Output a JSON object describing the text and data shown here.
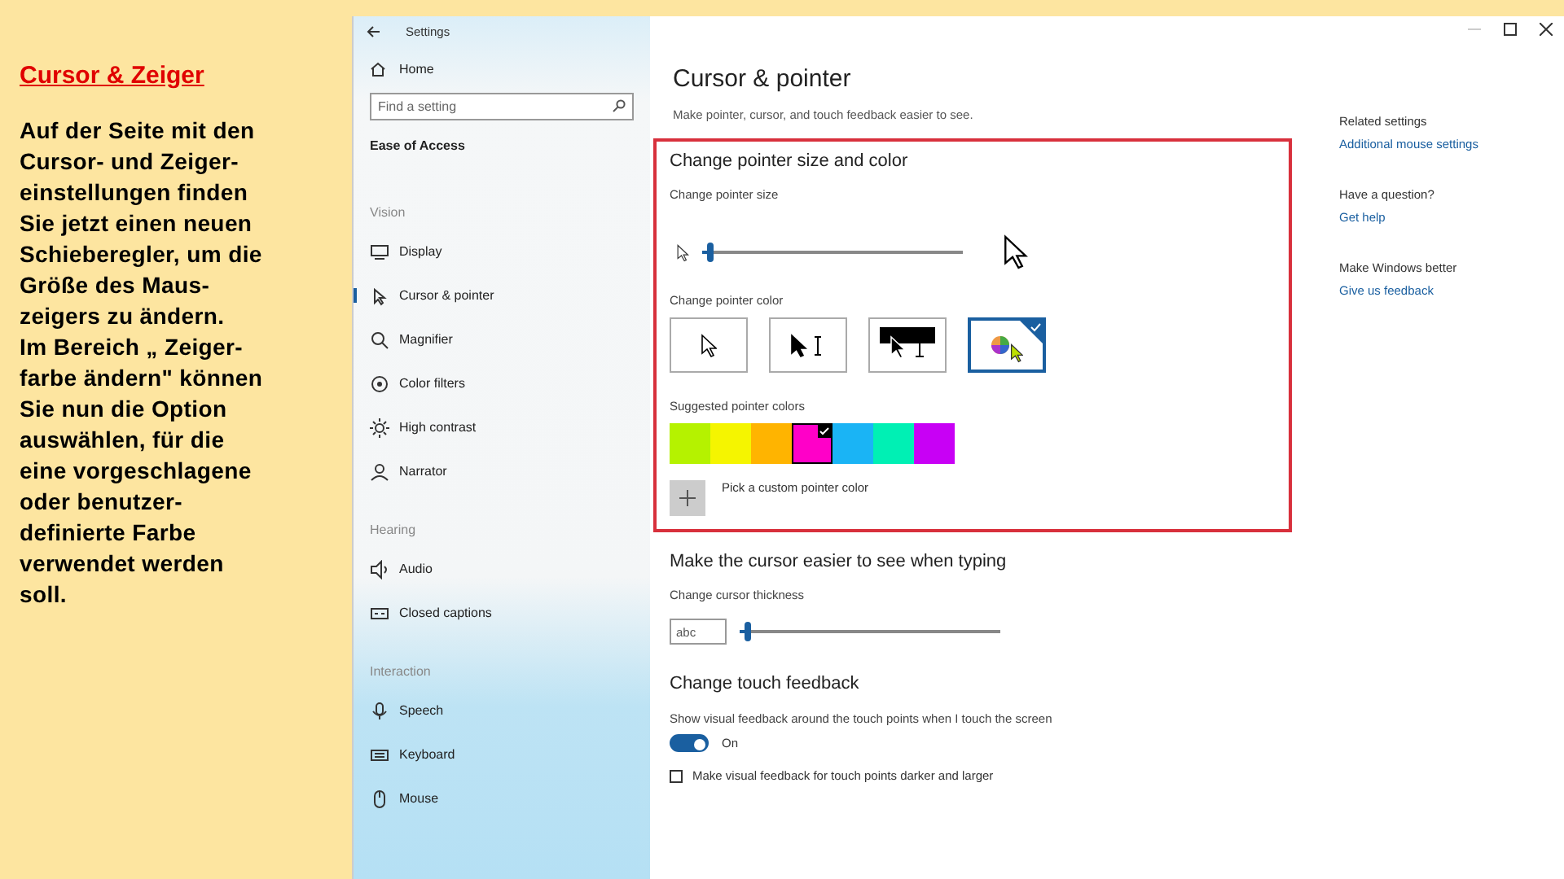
{
  "slide": {
    "title": "Cursor & Zeiger",
    "body": "Auf der Seite mit den\nCursor- und Zeiger-\neinstellungen finden\nSie jetzt einen neuen\nSchieberegler, um die\nGröße des Maus-\nzeigers zu ändern.\nIm Bereich „ Zeiger-\nfarbe ändern\" können\nSie nun die Option\nauswählen, für die\neine vorgeschlagene\noder benutzer-\ndefinierte Farbe\nverwendet werden\nsoll."
  },
  "window": {
    "title": "Settings"
  },
  "sidebar": {
    "home": "Home",
    "search": {
      "placeholder": "Find a setting"
    },
    "heading": "Ease of Access",
    "groups": [
      {
        "label": "Vision",
        "items": [
          {
            "label": "Display",
            "selected": false
          },
          {
            "label": "Cursor & pointer",
            "selected": true
          },
          {
            "label": "Magnifier",
            "selected": false
          },
          {
            "label": "Color filters",
            "selected": false
          },
          {
            "label": "High contrast",
            "selected": false
          },
          {
            "label": "Narrator",
            "selected": false
          }
        ]
      },
      {
        "label": "Hearing",
        "items": [
          {
            "label": "Audio",
            "selected": false
          },
          {
            "label": "Closed captions",
            "selected": false
          }
        ]
      },
      {
        "label": "Interaction",
        "items": [
          {
            "label": "Speech",
            "selected": false
          },
          {
            "label": "Keyboard",
            "selected": false
          },
          {
            "label": "Mouse",
            "selected": false
          }
        ]
      }
    ]
  },
  "main": {
    "title": "Cursor & pointer",
    "subtitle": "Make pointer, cursor, and touch feedback easier to see.",
    "pointer_section": {
      "heading": "Change pointer size and color",
      "size_label": "Change pointer size",
      "size_slider": {
        "level": 0.02
      },
      "color_label": "Change pointer color",
      "color_options": [
        {
          "kind": "white",
          "selected": false
        },
        {
          "kind": "black",
          "selected": false
        },
        {
          "kind": "inverted",
          "selected": false
        },
        {
          "kind": "custom",
          "selected": true
        }
      ],
      "suggested_label": "Suggested pointer colors",
      "suggested_colors": [
        {
          "color": "#b5f200",
          "selected": false
        },
        {
          "color": "#f5f500",
          "selected": false
        },
        {
          "color": "#ffb400",
          "selected": false
        },
        {
          "color": "#ff00c8",
          "selected": true
        },
        {
          "color": "#1ab4f5",
          "selected": false
        },
        {
          "color": "#00f0b4",
          "selected": false
        },
        {
          "color": "#c800f5",
          "selected": false
        }
      ],
      "custom_color": "Pick a custom pointer color"
    },
    "cursor_section": {
      "heading": "Make the cursor easier to see when typing",
      "thickness_label": "Change cursor thickness",
      "preview": "abc",
      "thickness_slider": {
        "level": 0.02
      }
    },
    "touch_section": {
      "heading": "Change touch feedback",
      "description": "Show visual feedback around the touch points when I touch the screen",
      "toggle": {
        "on": true,
        "label": "On"
      },
      "darker": {
        "checked": false,
        "label": "Make visual feedback for touch points darker and larger"
      }
    }
  },
  "related": [
    {
      "heading": "Related settings",
      "link": "Additional mouse settings"
    },
    {
      "heading": "Have a question?",
      "link": "Get help"
    },
    {
      "heading": "Make Windows better",
      "link": "Give us feedback"
    }
  ]
}
